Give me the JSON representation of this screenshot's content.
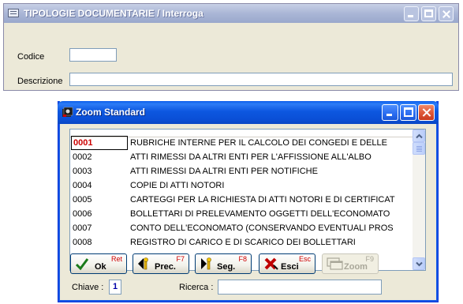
{
  "main_window": {
    "title": "TIPOLOGIE DOCUMENTARIE / Interroga",
    "codice_label": "Codice",
    "codice_value": "",
    "descrizione_label": "Descrizione",
    "descrizione_value": ""
  },
  "zoom_window": {
    "title": "Zoom Standard",
    "rows": [
      {
        "code": "0001",
        "desc": "RUBRICHE INTERNE PER IL CALCOLO DEI CONGEDI E DELLE"
      },
      {
        "code": "0002",
        "desc": "ATTI RIMESSI DA ALTRI ENTI PER L'AFFISSIONE ALL'ALBO"
      },
      {
        "code": "0003",
        "desc": "ATTI RIMESSI DA ALTRI ENTI PER NOTIFICHE"
      },
      {
        "code": "0004",
        "desc": "COPIE DI ATTI NOTORI"
      },
      {
        "code": "0005",
        "desc": "CARTEGGI PER LA RICHIESTA DI ATTI NOTORI E DI CERTIFICAT"
      },
      {
        "code": "0006",
        "desc": "BOLLETTARI DI PRELEVAMENTO OGGETTI DELL'ECONOMATO"
      },
      {
        "code": "0007",
        "desc": "CONTO DELL'ECONOMATO (CONSERVANDO EVENTUALI PROS"
      },
      {
        "code": "0008",
        "desc": "REGISTRO DI CARICO E DI SCARICO DEI BOLLETTARI"
      }
    ],
    "selected_index": 0,
    "buttons": {
      "ok": {
        "label": "Ok",
        "key": "Ret"
      },
      "prec": {
        "label": "Prec.",
        "key": "F7"
      },
      "seg": {
        "label": "Seg.",
        "key": "F8"
      },
      "esci": {
        "label": "Esci",
        "key": "Esc"
      },
      "zoom": {
        "label": "Zoom",
        "key": "F9"
      }
    },
    "chiave_label": "Chiave :",
    "chiave_value": "1",
    "ricerca_label": "Ricerca :",
    "ricerca_value": ""
  },
  "colors": {
    "selected_code": "#cc0000",
    "xp_title_blue": "#0a4fd6",
    "inactive_title": "#aab6d6",
    "window_face": "#ece9d8"
  }
}
